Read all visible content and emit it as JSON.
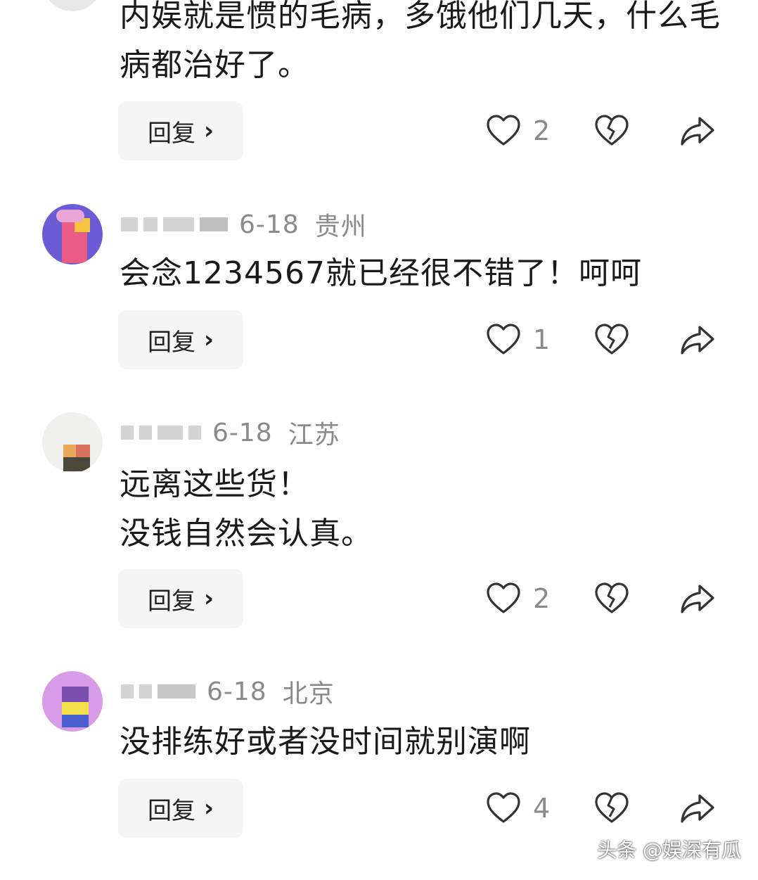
{
  "comments": [
    {
      "date": "",
      "location": "",
      "text": "内娱就是惯的毛病，多饿他们几天，什么毛\n病都治好了。",
      "reply_label": "回复",
      "like_count": "2"
    },
    {
      "date": "6-18",
      "location": "贵州",
      "text": "会念1234567就已经很不错了！呵呵",
      "reply_label": "回复",
      "like_count": "1"
    },
    {
      "date": "6-18",
      "location": "江苏",
      "text": "远离这些货！\n没钱自然会认真。",
      "reply_label": "回复",
      "like_count": "2"
    },
    {
      "date": "6-18",
      "location": "北京",
      "text": "没排练好或者没时间就别演啊",
      "reply_label": "回复",
      "like_count": "4"
    }
  ],
  "icons": {
    "like": "heart-outline-icon",
    "dislike": "broken-heart-icon",
    "share": "share-arrow-icon",
    "reply_chevron": "chevron-right-icon"
  },
  "colors": {
    "text": "#1a1a1a",
    "meta": "#8a8a8a",
    "button_bg": "#f5f5f5",
    "icon": "#333333"
  },
  "watermark": "头条 @娱深有瓜"
}
